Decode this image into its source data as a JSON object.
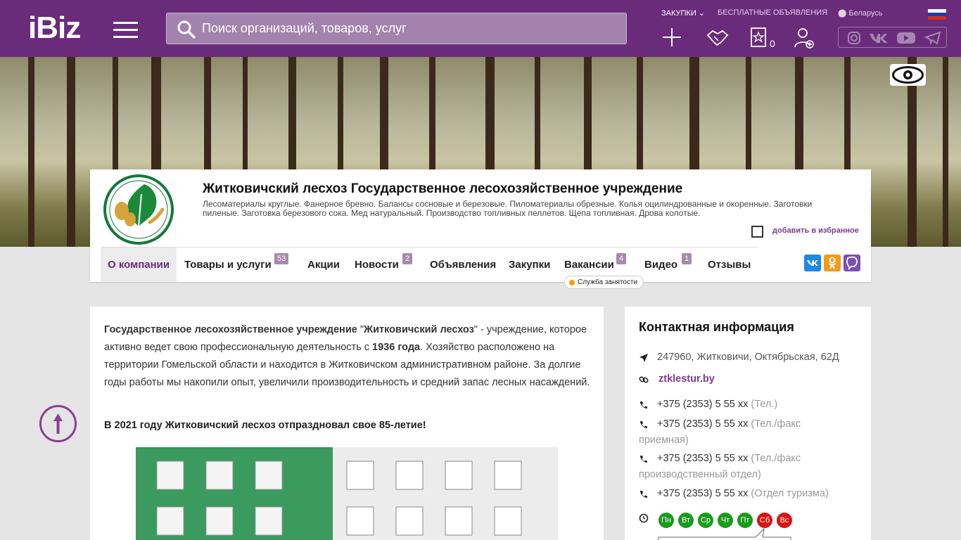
{
  "header": {
    "logo_text": "iBiz",
    "search_placeholder": "Поиск организаций, товаров, услуг",
    "links": {
      "procurement": "ЗАКУПКИ",
      "free_ads": "БЕСПЛАТНЫЕ ОБЪЯВЛЕНИЯ",
      "region": "Беларусь"
    },
    "favorites_count": "0",
    "icons": [
      "plus-icon",
      "handshake-icon",
      "favorites-icon",
      "user-add-icon"
    ],
    "social": [
      "instagram-icon",
      "vk-icon",
      "youtube-icon",
      "telegram-icon"
    ]
  },
  "company": {
    "title": "Житковичский лесхоз Государственное лесохозяйственное учреждение",
    "description": "Лесоматериалы круглые. Фанерное бревно. Балансы сосновые и березовые. Пиломатериалы обрезные. Колья оцилиндрованные и окоренные. Заготовки пиленые. Заготовка березового сока. Мед натуральный. Производство топливных пеллетов. Щепа топливная. Дрова колотые.",
    "favorite_label": "добавить в избранное",
    "tabs": [
      {
        "label": "О компании",
        "badge": ""
      },
      {
        "label": "Товары и услуги",
        "badge": "53"
      },
      {
        "label": "Акции",
        "badge": ""
      },
      {
        "label": "Новости",
        "badge": "2"
      },
      {
        "label": "Объявления",
        "badge": ""
      },
      {
        "label": "Закупки",
        "badge": ""
      },
      {
        "label": "Вакансии",
        "badge": "4"
      },
      {
        "label": "Видео",
        "badge": "1"
      },
      {
        "label": "Отзывы",
        "badge": ""
      }
    ],
    "employment_tag": "Служба занятости"
  },
  "about": {
    "p1_a": "Государственное лесохозяйственное учреждение",
    "p1_b": " \"",
    "p1_c": "Житковичский лесхоз",
    "p1_d": "\" - учреждение,  которое активно ведет свою профессиональную деятельность с ",
    "p1_e": "1936 года",
    "p1_f": ". Хозяйство расположено на территории Гомельской области и находится в Житковичском административном районе. За долгие годы работы мы накопили опыт, увеличили производительность и средний запас лесных насаждений.",
    "p2": "В 2021 году Житковичский лесхоз отпраздновал свое 85-летие!"
  },
  "contacts": {
    "title": "Контактная информация",
    "address": "247960, Житковичи, Октябрьская, 62Д",
    "website": "ztklestur.by",
    "phones": [
      {
        "number": "+375 (2353) 5 55 xx",
        "note": "(Тел.)"
      },
      {
        "number": "+375 (2353) 5 55 xx",
        "note": "(Тел./факс"
      },
      {
        "number": "",
        "note": "приемная)"
      },
      {
        "number": "+375 (2353) 5 55 xx",
        "note": "(Тел./факс"
      },
      {
        "number": "",
        "note": "производственный отдел)"
      },
      {
        "number": "+375 (2353) 5 55 xx",
        "note": "(Отдел туризма)"
      }
    ],
    "days": [
      {
        "label": "Пн",
        "color": "#1a9b1a"
      },
      {
        "label": "Вт",
        "color": "#1a9b1a"
      },
      {
        "label": "Ср",
        "color": "#1a9b1a"
      },
      {
        "label": "Чт",
        "color": "#1a9b1a"
      },
      {
        "label": "Пт",
        "color": "#1a9b1a"
      },
      {
        "label": "Сб",
        "color": "#dd1111"
      },
      {
        "label": "Вс",
        "color": "#dd1111"
      }
    ]
  },
  "colors": {
    "brand": "#6a2c7a",
    "link": "#7c3b8f",
    "badge": "#a78aad"
  }
}
